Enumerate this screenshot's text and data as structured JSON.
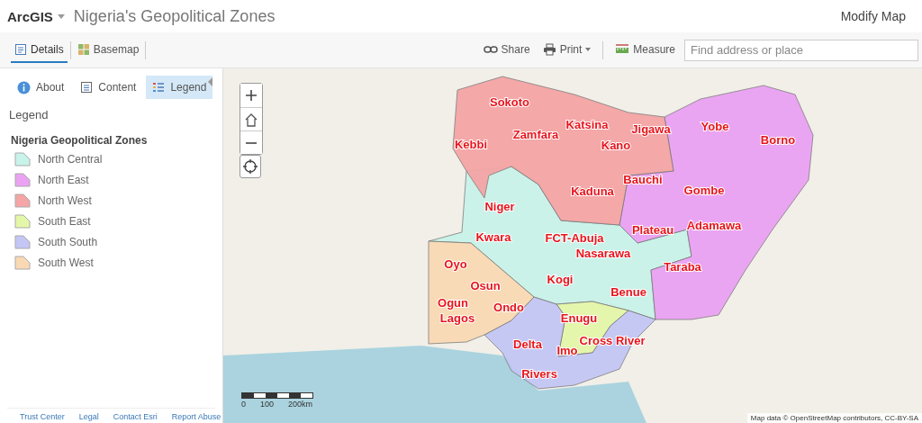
{
  "app": {
    "brand": "ArcGIS",
    "title": "Nigeria's Geopolitical Zones",
    "action": "Modify Map"
  },
  "toolbar": {
    "tabs": [
      {
        "label": "Details",
        "kind": "details",
        "selected": true
      },
      {
        "label": "Basemap",
        "kind": "basemap",
        "selected": false
      }
    ],
    "tools": [
      {
        "kind": "share",
        "label": "Share"
      },
      {
        "kind": "print",
        "label": "Print"
      },
      {
        "kind": "measure",
        "label": "Measure"
      }
    ],
    "search": {
      "placeholder": "Find address or place"
    }
  },
  "panel": {
    "tabs": [
      {
        "kind": "about",
        "label": "About",
        "selected": false
      },
      {
        "kind": "content",
        "label": "Content",
        "selected": false
      },
      {
        "kind": "legend",
        "label": "Legend",
        "selected": true
      }
    ],
    "heading": "Legend",
    "layer": "Nigeria Geopolitical Zones",
    "legend": [
      {
        "label": "North Central",
        "color": "#c8f3ea"
      },
      {
        "label": "North East",
        "color": "#eaa2f3"
      },
      {
        "label": "North West",
        "color": "#f5a5a5"
      },
      {
        "label": "South East",
        "color": "#e4f7a8"
      },
      {
        "label": "South South",
        "color": "#c4c6f5"
      },
      {
        "label": "South West",
        "color": "#f9d9b4"
      }
    ],
    "footer_links": [
      "Trust Center",
      "Legal",
      "Contact Esri",
      "Report Abuse"
    ]
  },
  "map": {
    "states": [
      "Sokoto",
      "Katsina",
      "Jigawa",
      "Yobe",
      "Borno",
      "Zamfara",
      "Kebbi",
      "Kano",
      "Bauchi",
      "Gombe",
      "Kaduna",
      "Niger",
      "Kwara",
      "FCT-Abuja",
      "Plateau",
      "Adamawa",
      "Nasarawa",
      "Oyo",
      "Taraba",
      "Osun",
      "Kogi",
      "Benue",
      "Ogun",
      "Ondo",
      "Lagos",
      "Enugu",
      "Cross River",
      "Delta",
      "Imo",
      "Rivers"
    ],
    "scale_labels": [
      "0",
      "100",
      "200km"
    ],
    "attribution": "Map data © OpenStreetMap contributors, CC-BY-SA"
  }
}
